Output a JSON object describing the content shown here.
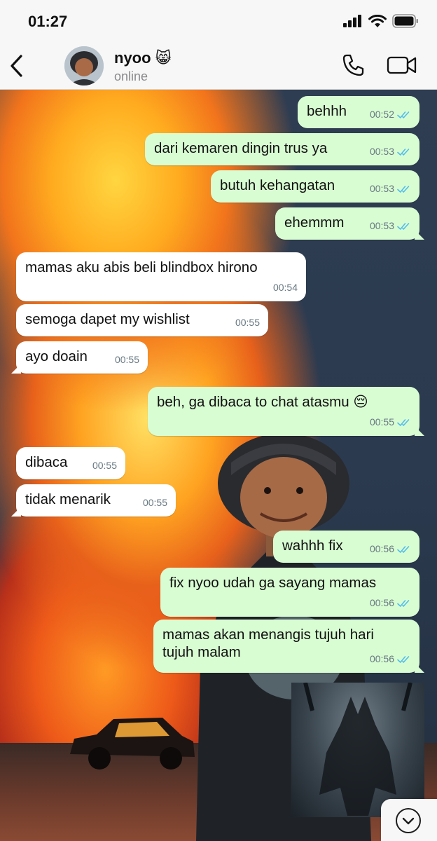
{
  "status_bar": {
    "time": "01:27"
  },
  "header": {
    "contact_name": "nyoo 😸",
    "contact_status": "online"
  },
  "icons": {
    "back": "chevron-left-icon",
    "call": "phone-icon",
    "video": "video-camera-icon",
    "scroll_down": "chevron-down-icon",
    "read_receipt": "double-check-icon"
  },
  "colors": {
    "outgoing_bubble": "#d9fdd3",
    "incoming_bubble": "#ffffff",
    "read_tick": "#53bdeb",
    "timestamp": "#667781"
  },
  "messages": [
    {
      "direction": "out",
      "lines": [
        "behhh"
      ],
      "time": "00:52",
      "status": "read"
    },
    {
      "direction": "out",
      "lines": [
        "dari kemaren dingin trus ya"
      ],
      "time": "00:53",
      "status": "read"
    },
    {
      "direction": "out",
      "lines": [
        "butuh kehangatan"
      ],
      "time": "00:53",
      "status": "read"
    },
    {
      "direction": "out",
      "lines": [
        "ehemmm"
      ],
      "time": "00:53",
      "status": "read"
    },
    {
      "direction": "in",
      "lines": [
        "mamas aku abis beli blindbox hirono"
      ],
      "time": "00:54"
    },
    {
      "direction": "in",
      "lines": [
        "semoga dapet my wishlist"
      ],
      "time": "00:55"
    },
    {
      "direction": "in",
      "lines": [
        "ayo doain"
      ],
      "time": "00:55"
    },
    {
      "direction": "out",
      "lines": [
        "beh, ga dibaca to chat atasmu 😔"
      ],
      "time": "00:55",
      "status": "read"
    },
    {
      "direction": "in",
      "lines": [
        "dibaca"
      ],
      "time": "00:55"
    },
    {
      "direction": "in",
      "lines": [
        "tidak menarik"
      ],
      "time": "00:55"
    },
    {
      "direction": "out",
      "lines": [
        "wahhh fix"
      ],
      "time": "00:56",
      "status": "read"
    },
    {
      "direction": "out",
      "lines": [
        "fix nyoo udah ga sayang mamas"
      ],
      "time": "00:56",
      "status": "read"
    },
    {
      "direction": "out",
      "lines": [
        "mamas akan menangis tujuh hari",
        "tujuh malam"
      ],
      "time": "00:56",
      "status": "read"
    }
  ]
}
